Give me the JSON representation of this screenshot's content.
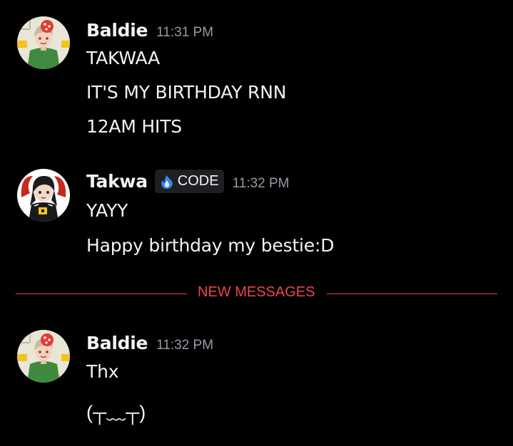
{
  "messages": [
    {
      "author": "Baldie",
      "time": "11:31 PM",
      "avatar": "baldie-avatar",
      "lines": [
        "TAKWAA",
        "IT'S MY BIRTHDAY RNN",
        "12AM HITS"
      ]
    },
    {
      "author": "Takwa",
      "time": "11:32 PM",
      "avatar": "takwa-avatar",
      "tag": {
        "icon": "flame-icon",
        "label": "CODE"
      },
      "lines": [
        "YAYY",
        "Happy birthday my bestie:D"
      ]
    },
    {
      "author": "Baldie",
      "time": "11:32 PM",
      "avatar": "baldie-avatar",
      "lines": [
        "Thx",
        "(┬﹏┬)"
      ]
    }
  ],
  "divider": {
    "label": "NEW MESSAGES"
  },
  "colors": {
    "background": "#000000",
    "text": "#f2f3f5",
    "muted": "#949ba4",
    "new_messages": "#f0444d",
    "tag_bg": "#1e1f22"
  }
}
